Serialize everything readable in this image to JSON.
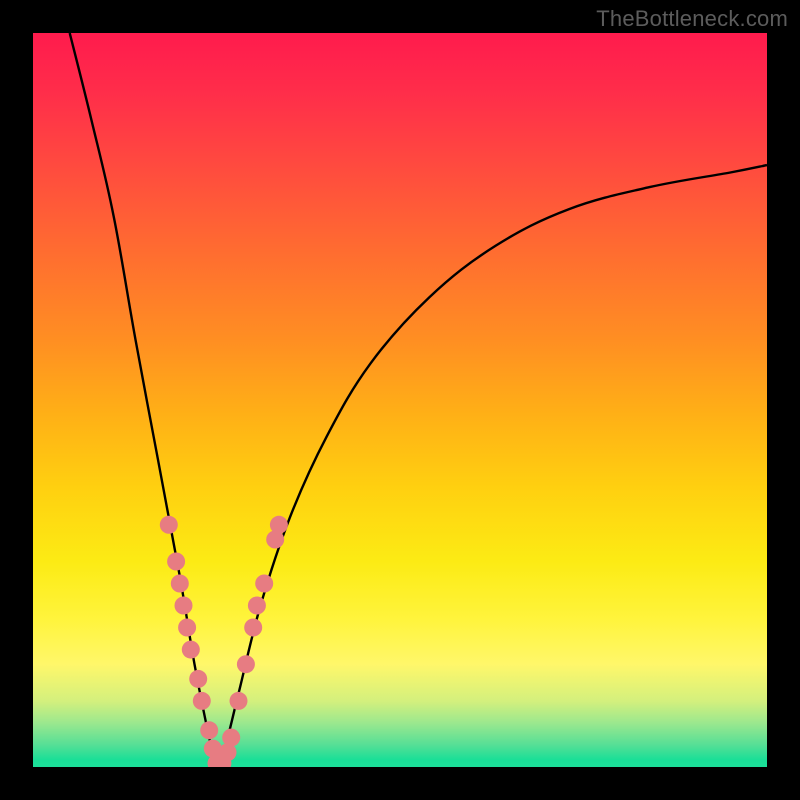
{
  "watermark": "TheBottleneck.com",
  "colors": {
    "curve": "#000000",
    "dot_fill": "#e77c82",
    "dot_stroke": "#e77c82",
    "background": "#000000"
  },
  "chart_data": {
    "type": "line",
    "title": "",
    "xlabel": "",
    "ylabel": "",
    "xlim": [
      0,
      100
    ],
    "ylim": [
      0,
      100
    ],
    "grid": false,
    "legend": false,
    "x_optimum": 25,
    "curve_points": [
      {
        "x": 5,
        "y": 100
      },
      {
        "x": 8,
        "y": 88
      },
      {
        "x": 11,
        "y": 75
      },
      {
        "x": 14,
        "y": 58
      },
      {
        "x": 17,
        "y": 42
      },
      {
        "x": 20,
        "y": 26
      },
      {
        "x": 22,
        "y": 14
      },
      {
        "x": 24,
        "y": 4
      },
      {
        "x": 25,
        "y": 0
      },
      {
        "x": 26,
        "y": 2
      },
      {
        "x": 28,
        "y": 10
      },
      {
        "x": 31,
        "y": 22
      },
      {
        "x": 35,
        "y": 34
      },
      {
        "x": 40,
        "y": 45
      },
      {
        "x": 46,
        "y": 55
      },
      {
        "x": 54,
        "y": 64
      },
      {
        "x": 63,
        "y": 71
      },
      {
        "x": 73,
        "y": 76
      },
      {
        "x": 84,
        "y": 79
      },
      {
        "x": 95,
        "y": 81
      },
      {
        "x": 100,
        "y": 82
      }
    ],
    "points": [
      {
        "x": 18.5,
        "y": 33
      },
      {
        "x": 19.5,
        "y": 28
      },
      {
        "x": 20,
        "y": 25
      },
      {
        "x": 20.5,
        "y": 22
      },
      {
        "x": 21,
        "y": 19
      },
      {
        "x": 21.5,
        "y": 16
      },
      {
        "x": 22.5,
        "y": 12
      },
      {
        "x": 23,
        "y": 9
      },
      {
        "x": 24,
        "y": 5
      },
      {
        "x": 24.5,
        "y": 2.5
      },
      {
        "x": 25,
        "y": 0.5
      },
      {
        "x": 25.8,
        "y": 0.5
      },
      {
        "x": 26.5,
        "y": 2
      },
      {
        "x": 27,
        "y": 4
      },
      {
        "x": 28,
        "y": 9
      },
      {
        "x": 29,
        "y": 14
      },
      {
        "x": 30,
        "y": 19
      },
      {
        "x": 30.5,
        "y": 22
      },
      {
        "x": 31.5,
        "y": 25
      },
      {
        "x": 33,
        "y": 31
      },
      {
        "x": 33.5,
        "y": 33
      }
    ]
  }
}
